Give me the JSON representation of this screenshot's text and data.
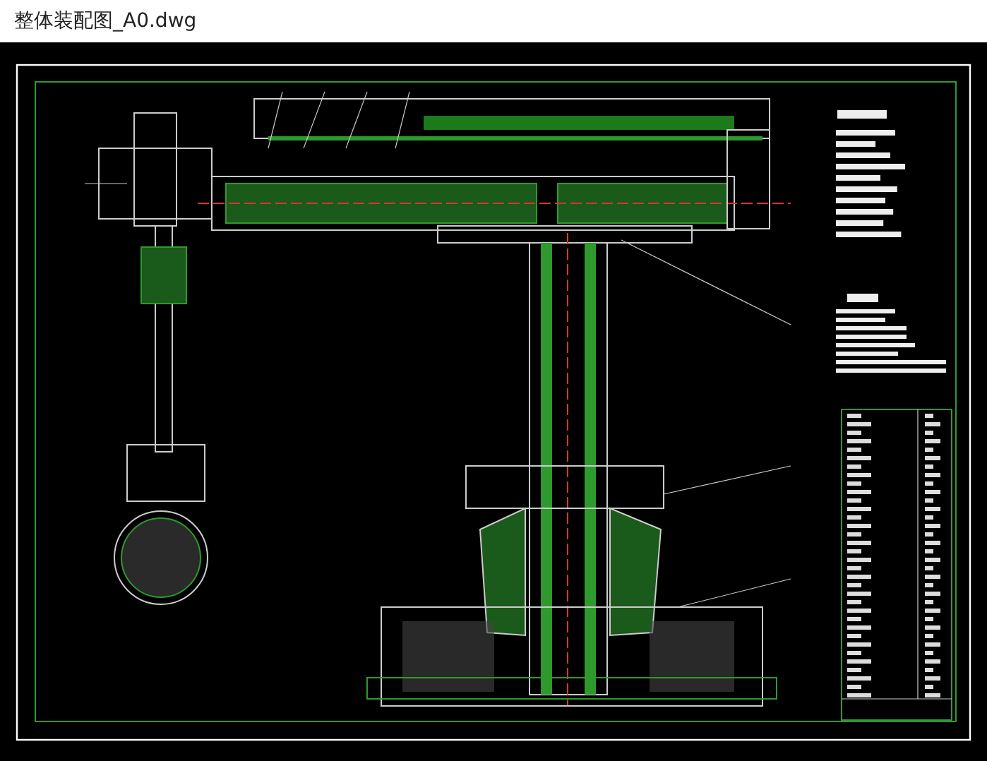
{
  "window": {
    "title": "整体装配图_A0.dwg"
  }
}
